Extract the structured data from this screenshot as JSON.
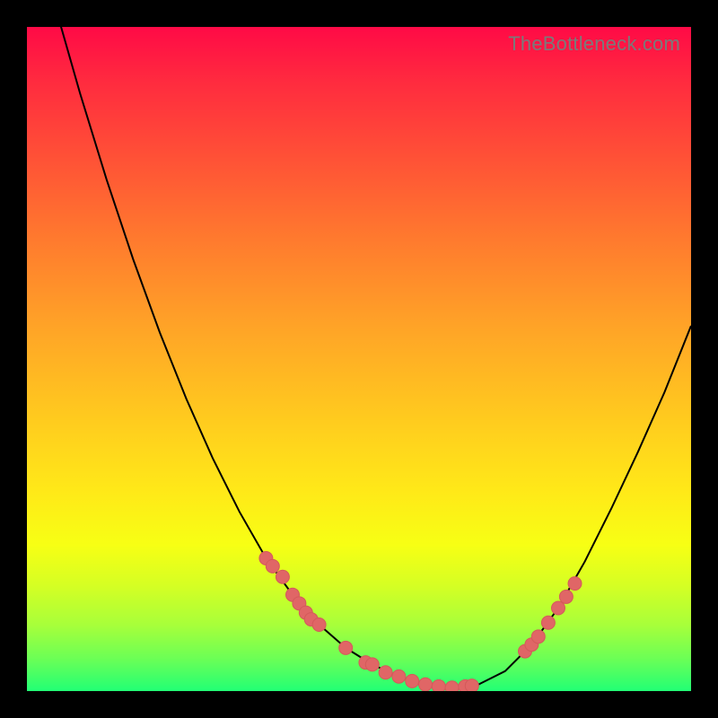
{
  "watermark": "TheBottleneck.com",
  "colors": {
    "page_bg": "#000000",
    "curve": "#000000",
    "marker": "#e06666",
    "gradient_top": "#ff0a46",
    "gradient_bottom": "#22ff75"
  },
  "chart_data": {
    "type": "line",
    "title": "",
    "xlabel": "",
    "ylabel": "",
    "xlim": [
      0,
      100
    ],
    "ylim": [
      0,
      100
    ],
    "x": [
      0,
      4,
      8,
      12,
      16,
      20,
      24,
      28,
      32,
      36,
      40,
      44,
      48,
      52,
      56,
      60,
      64,
      68,
      72,
      76,
      80,
      84,
      88,
      92,
      96,
      100
    ],
    "values": [
      120,
      104,
      90,
      77,
      65,
      54,
      44,
      35,
      27,
      20,
      14.5,
      10,
      6.5,
      4,
      2.2,
      1,
      0.5,
      1,
      3,
      7,
      12.5,
      19.5,
      27.5,
      36,
      45,
      55
    ],
    "series": [
      {
        "name": "marker-cluster-left",
        "x": [
          36,
          37,
          38.5,
          40,
          41,
          42,
          42.8,
          44
        ],
        "values": [
          20,
          18.8,
          17.2,
          14.5,
          13.2,
          11.8,
          10.8,
          10
        ]
      },
      {
        "name": "marker-cluster-bottom",
        "x": [
          48,
          51,
          52,
          54,
          56,
          58,
          60,
          62,
          64,
          66,
          67
        ],
        "values": [
          6.5,
          4.3,
          4.0,
          2.8,
          2.2,
          1.5,
          1.0,
          0.7,
          0.5,
          0.7,
          0.8
        ]
      },
      {
        "name": "marker-cluster-right",
        "x": [
          75,
          76,
          77,
          78.5,
          80,
          81.2,
          82.5
        ],
        "values": [
          6.0,
          7.0,
          8.2,
          10.3,
          12.5,
          14.2,
          16.2
        ]
      }
    ]
  }
}
